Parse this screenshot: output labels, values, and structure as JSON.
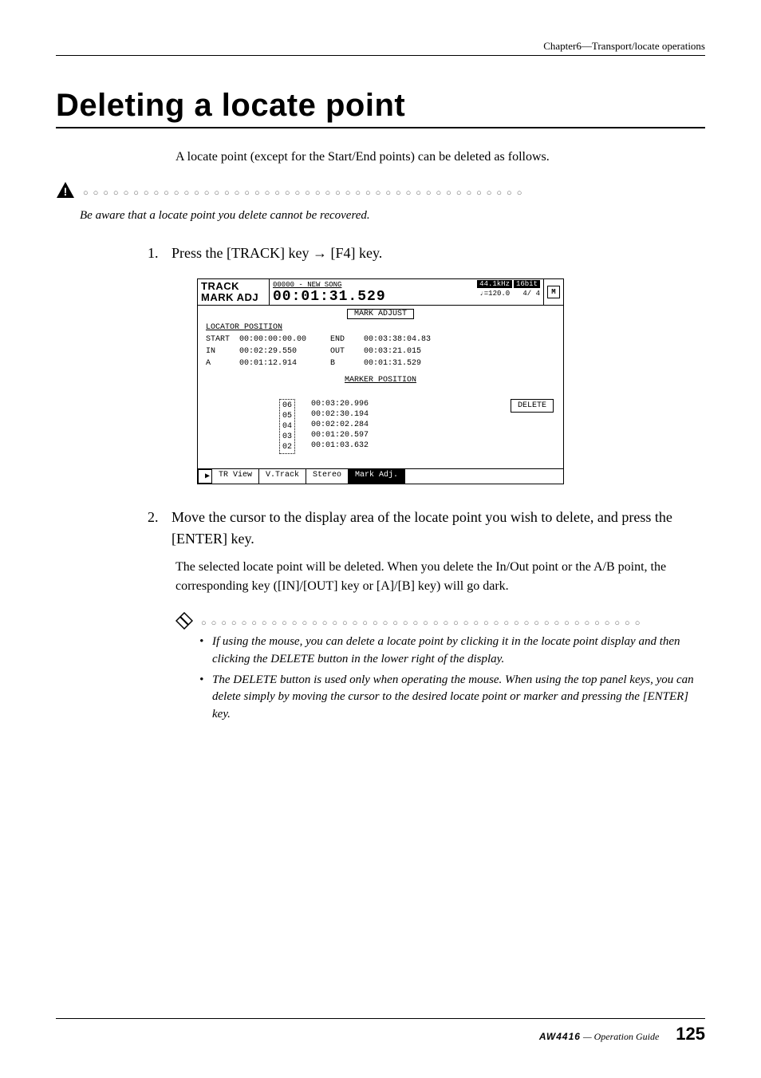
{
  "header": {
    "chapter": "Chapter6—Transport/locate operations"
  },
  "title": "Deleting a locate point",
  "intro": "A locate point (except for the Start/End points) can be deleted as follows.",
  "warning": "Be aware that a locate point you delete cannot be recovered.",
  "steps": {
    "s1_num": "1.",
    "s1": "Press the [TRACK] key → [F4] key.",
    "s2_num": "2.",
    "s2": "Move the cursor to the display area of the locate point you wish to delete, and press the [ENTER] key.",
    "s2_desc": "The selected locate point will be deleted. When you delete the In/Out point or the A/B point, the corresponding key ([IN]/[OUT] key or [A]/[B] key) will go dark."
  },
  "tips": {
    "t1": "If using the mouse, you can delete a locate point by clicking it in the locate point display and then clicking the DELETE button in the lower right of the display.",
    "t2": "The DELETE button is used only when operating the mouse. When using the top panel keys, you can delete simply by moving the cursor to the desired locate point or marker and pressing the [ENTER] key."
  },
  "screen": {
    "track_label": "TRACK",
    "mark_adj_label": "MARK ADJ",
    "song": "00000 - NEW SONG",
    "time": "00:01:31.529",
    "rate": "44.1kHz",
    "bits": "16bit",
    "tempo": "♩=120.0",
    "sig": "4/ 4",
    "m_badge": "M",
    "mark_adjust": "MARK ADJUST",
    "locator_position": "LOCATOR POSITION",
    "loc_left": "START  00:00:00:00.00\nIN     00:02:29.550\nA      00:01:12.914",
    "loc_right": "END    00:03:38:04.83\nOUT    00:03:21.015\nB      00:01:31.529",
    "marker_position": "MARKER  POSITION",
    "marker_nums": "06\n05\n04\n03\n02",
    "marker_times": "00:03:20.996\n00:02:30.194\n00:02:02.284\n00:01:20.597\n00:01:03.632",
    "delete": "DELETE",
    "tabs": {
      "play": "▶",
      "t1": "TR View",
      "t2": "V.Track",
      "t3": "Stereo",
      "t4": "Mark Adj."
    }
  },
  "footer": {
    "model": "AW4416",
    "guide": " — Operation Guide",
    "page": "125"
  }
}
